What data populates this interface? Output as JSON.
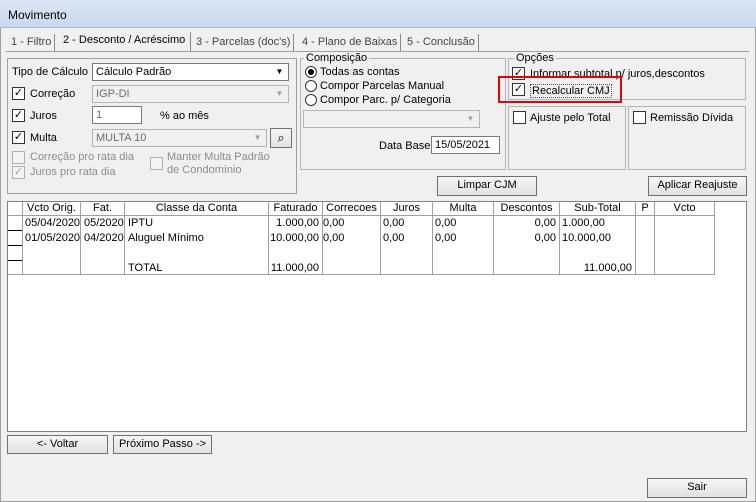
{
  "window": {
    "title": "Movimento"
  },
  "tabs": [
    {
      "label": "1 - Filtro"
    },
    {
      "label": "2 - Desconto / Acréscimo"
    },
    {
      "label": "3 - Parcelas (doc's)"
    },
    {
      "label": "4 - Plano de Baixas"
    },
    {
      "label": "5 - Conclusão"
    }
  ],
  "calc": {
    "tipo_label": "Tipo de Cálculo",
    "tipo_value": "Cálculo Padrão",
    "correcao_label": "Correção",
    "correcao_value": "IGP-DI",
    "juros_label": "Juros",
    "juros_value": "1",
    "juros_unit": "% ao mês",
    "multa_label": "Multa",
    "multa_value": "MULTA 10",
    "correcao_rata_label": "Correção pro rata dia",
    "juros_rata_label": "Juros pro rata dia",
    "manter_multa_label_1": "Manter Multa Padrão",
    "manter_multa_label_2": "de Condomínio"
  },
  "composicao": {
    "title": "Composição",
    "options": [
      "Todas as contas",
      "Compor Parcelas Manual",
      "Compor Parc. p/ Categoria"
    ],
    "data_base_label": "Data Base",
    "data_base_value": "15/05/2021"
  },
  "opcoes": {
    "title": "Opções",
    "informar_subtotal": "Informar subtotal p/ juros,descontos",
    "recalcular_cmj": "Recalcular CMJ",
    "ajuste_total": "Ajuste pelo Total",
    "remissao_divida": "Remissão Dívida"
  },
  "buttons": {
    "limpar_cjm": "Limpar CJM",
    "aplicar_reajuste": "Aplicar Reajuste",
    "voltar": "<- Voltar",
    "proximo": "Próximo Passo ->",
    "sair": "Sair"
  },
  "table": {
    "headers": [
      "Vcto Orig.",
      "Fat.",
      "Classe da Conta",
      "Faturado",
      "Correcoes",
      "Juros",
      "Multa",
      "Descontos",
      "Sub-Total",
      "P",
      "Vcto"
    ],
    "rows": [
      [
        "05/04/2020",
        "05/2020",
        "IPTU",
        "1.000,00",
        "0,00",
        "0,00",
        "0,00",
        "0,00",
        "1.000,00",
        "",
        ""
      ],
      [
        "01/05/2020",
        "04/2020",
        "Aluguel Mínimo",
        "10.000,00",
        "0,00",
        "0,00",
        "0,00",
        "0,00",
        "10.000,00",
        "",
        ""
      ]
    ],
    "total": {
      "label": "TOTAL",
      "faturado": "11.000,00",
      "subtotal": "11.000,00"
    }
  },
  "colors": {
    "highlight": "#e00000",
    "titlebar": "#c9d9ef"
  }
}
